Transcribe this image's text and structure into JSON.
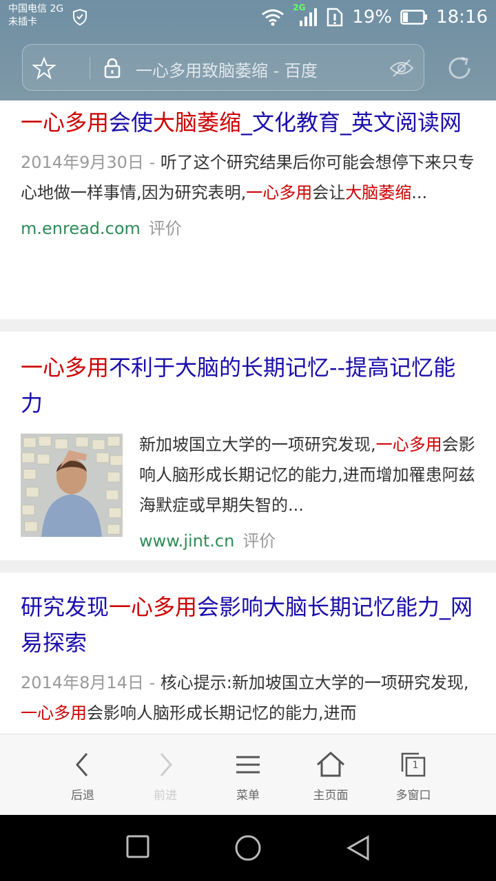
{
  "status_bar": {
    "carrier_line1": "中国电信 2G",
    "carrier_line2": "未插卡",
    "network_tag": "2G",
    "battery": "19%",
    "time": "18:16"
  },
  "address_bar": {
    "url_text": "一心多用致脑萎缩 - 百度"
  },
  "results": [
    {
      "title_parts": [
        "一心多用",
        "会使",
        "大脑萎缩",
        "_文化教育_英文阅读网"
      ],
      "date": "2014年9月30日 - ",
      "snippet_parts": [
        "听了这个研究结果后你可能会想停下来只专心地做一样事情,因为研究表明,",
        "一心多用",
        "会让",
        "大脑萎缩",
        "..."
      ],
      "site": "m.enread.com",
      "rate": "评价"
    },
    {
      "title_parts": [
        "一心多用",
        "不利于大脑的长期记忆--提高记忆能力"
      ],
      "snippet_parts": [
        "新加坡国立大学的一项研究发现,",
        "一心多用",
        "会影响人脑形成长期记忆的能力,进而增加罹患阿兹海默症或早期失智的..."
      ],
      "site": "www.jint.cn",
      "rate": "评价"
    },
    {
      "title_parts": [
        "研究发现",
        "一心多用",
        "会影响大脑长期记忆能力_网易探索"
      ],
      "date": "2014年8月14日 - ",
      "snippet_parts": [
        "核心提示:新加坡国立大学的一项研究发现,",
        "一心多用",
        "会影响人脑形成长期记忆的能力,进而"
      ]
    }
  ],
  "toolbar": {
    "back": "后退",
    "forward": "前进",
    "menu": "菜单",
    "home": "主页面",
    "windows": "多窗口",
    "window_count": "1"
  },
  "colors": {
    "link": "#1a0dab",
    "highlight": "#cc0000",
    "site": "#2e8b57"
  }
}
